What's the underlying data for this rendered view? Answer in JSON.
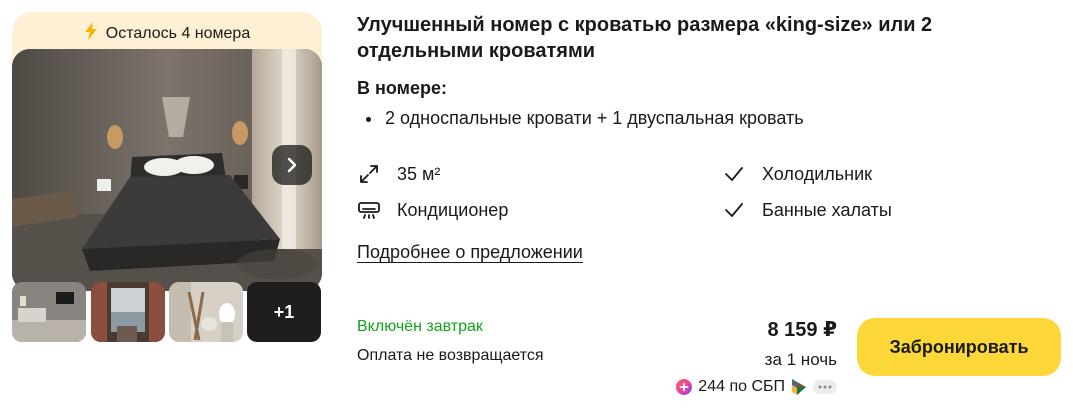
{
  "availability": {
    "text": "Осталось 4 номера",
    "icon": "lightning-icon"
  },
  "gallery": {
    "more_label": "+1"
  },
  "room": {
    "title": "Улучшенный номер с кроватью размера «king-size» или 2 отдельными кроватями",
    "in_room_heading": "В номере:",
    "beds": "2 односпальные кровати + 1 двуспальная кровать",
    "amenities": [
      {
        "label": "35 м²",
        "icon": "area-expand-icon"
      },
      {
        "label": "Кондиционер",
        "icon": "air-conditioner-icon"
      },
      {
        "label": "Холодильник",
        "icon": "checkmark-icon"
      },
      {
        "label": "Банные халаты",
        "icon": "checkmark-icon"
      }
    ],
    "details_link": "Подробнее о предложении"
  },
  "offer": {
    "breakfast": "Включён завтрак",
    "refund": "Оплата не возвращается",
    "price": "8 159 ₽",
    "per_night": "за 1 ночь",
    "sbp": "244 по СБП",
    "book_label": "Забронировать"
  },
  "colors": {
    "accent": "#fcd737",
    "availability_bg": "#fdf0d4",
    "breakfast_green": "#12a31c",
    "text": "#1a1a1a"
  }
}
